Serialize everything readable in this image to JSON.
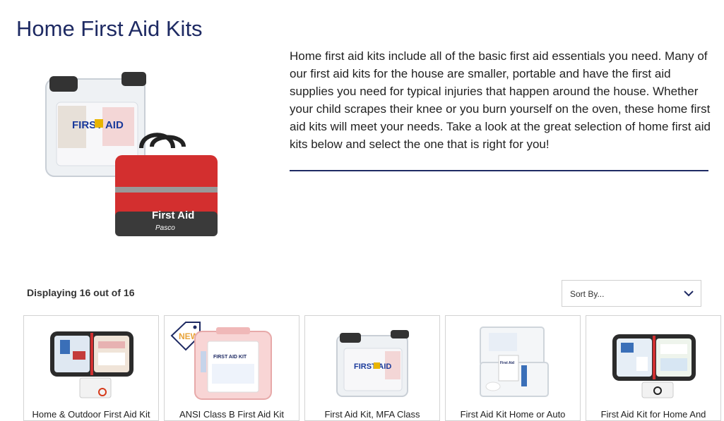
{
  "page": {
    "title": "Home First Aid Kits",
    "description": "Home first aid kits include all of the basic first aid essentials you need.  Many of our first aid kits for the house are smaller, portable and have the first aid supplies you need for typical injuries that happen around the house.  Whether your child scrapes their knee or you burn yourself on the oven, these home first aid kits will meet your needs.  Take a look at the great selection of home first aid kits below and select the one that is right for you!"
  },
  "hero": {
    "case_text": "FIRST AID",
    "bag_text": "First Aid",
    "brand": "Pasco"
  },
  "listing": {
    "count_text": "Displaying 16 out of 16",
    "sort_label": "Sort By..."
  },
  "products": [
    {
      "name": "Home & Outdoor First Aid Kit",
      "badge": ""
    },
    {
      "name": "ANSI Class B First Aid Kit",
      "badge": "NEW",
      "box_text": "FIRST AID KIT"
    },
    {
      "name": "First Aid Kit, MFA Class",
      "badge": "",
      "case_text": "FIRST AID"
    },
    {
      "name": "First Aid Kit Home or Auto",
      "badge": "",
      "pack_text": "First Aid"
    },
    {
      "name": "First Aid Kit for Home And",
      "badge": ""
    }
  ],
  "colors": {
    "title": "#1e2a63",
    "rule": "#1e2a63",
    "badge": "#e8a33a",
    "bag": "#d32f2f"
  }
}
